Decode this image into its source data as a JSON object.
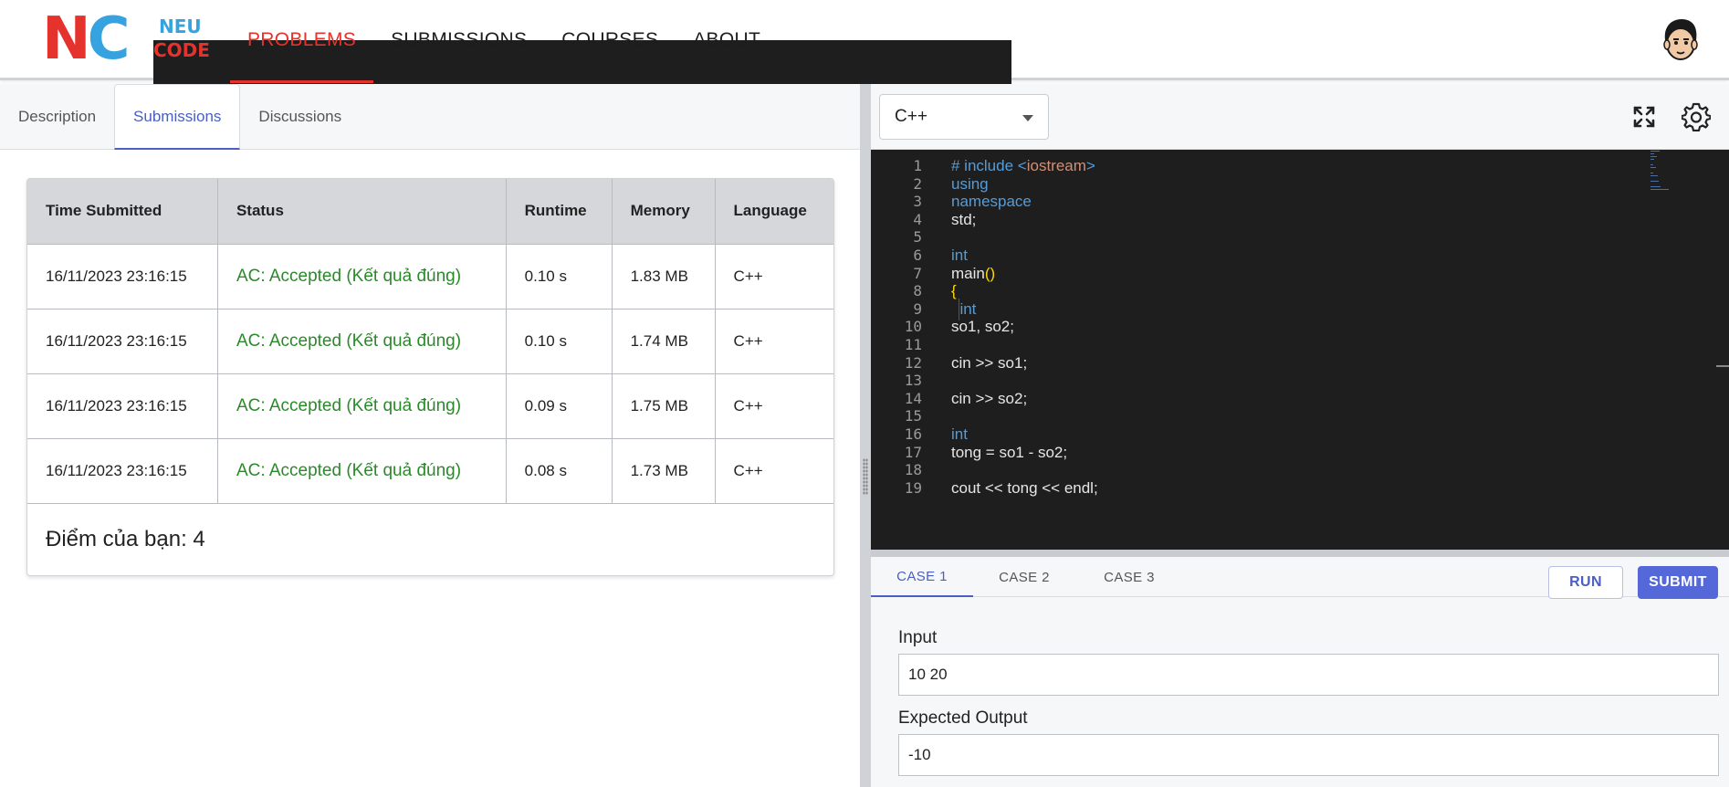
{
  "logo": {
    "big": "NC",
    "line1": "NEU",
    "line2": "CODE"
  },
  "nav": [
    {
      "label": "PROBLEMS",
      "active": true
    },
    {
      "label": "SUBMISSIONS",
      "active": false
    },
    {
      "label": "COURSES",
      "active": false
    },
    {
      "label": "ABOUT",
      "active": false
    }
  ],
  "left_tabs": [
    {
      "label": "Description",
      "active": false
    },
    {
      "label": "Submissions",
      "active": true
    },
    {
      "label": "Discussions",
      "active": false
    }
  ],
  "submissions": {
    "headers": [
      "Time Submitted",
      "Status",
      "Runtime",
      "Memory",
      "Language"
    ],
    "rows": [
      {
        "time": "16/11/2023 23:16:15",
        "status": "AC: Accepted (Kết quả đúng)",
        "runtime": "0.10 s",
        "memory": "1.83 MB",
        "language": "C++"
      },
      {
        "time": "16/11/2023 23:16:15",
        "status": "AC: Accepted (Kết quả đúng)",
        "runtime": "0.10 s",
        "memory": "1.74 MB",
        "language": "C++"
      },
      {
        "time": "16/11/2023 23:16:15",
        "status": "AC: Accepted (Kết quả đúng)",
        "runtime": "0.09 s",
        "memory": "1.75 MB",
        "language": "C++"
      },
      {
        "time": "16/11/2023 23:16:15",
        "status": "AC: Accepted (Kết quả đúng)",
        "runtime": "0.08 s",
        "memory": "1.73 MB",
        "language": "C++"
      }
    ],
    "score_text": "Điểm của bạn: 4"
  },
  "editor": {
    "language": "C++",
    "lines": [
      {
        "n": "1",
        "tokens": [
          [
            "kw",
            "# include "
          ],
          [
            "kw",
            "<"
          ],
          [
            "str",
            "iostream"
          ],
          [
            "kw",
            ">"
          ]
        ]
      },
      {
        "n": "2",
        "tokens": [
          [
            "kw",
            "using"
          ]
        ]
      },
      {
        "n": "3",
        "tokens": [
          [
            "kw",
            "namespace"
          ]
        ]
      },
      {
        "n": "4",
        "tokens": [
          [
            "",
            "std;"
          ]
        ]
      },
      {
        "n": "5",
        "tokens": []
      },
      {
        "n": "6",
        "tokens": [
          [
            "kw",
            "int"
          ]
        ]
      },
      {
        "n": "7",
        "tokens": [
          [
            "",
            "main"
          ],
          [
            "br",
            "()"
          ]
        ]
      },
      {
        "n": "8",
        "tokens": [
          [
            "br",
            "{"
          ]
        ]
      },
      {
        "n": "9",
        "tokens": [
          [
            "kw",
            "  int"
          ]
        ],
        "guide": true
      },
      {
        "n": "10",
        "tokens": [
          [
            "",
            "so1, so2;"
          ]
        ]
      },
      {
        "n": "11",
        "tokens": []
      },
      {
        "n": "12",
        "tokens": [
          [
            "",
            "cin >> so1;"
          ]
        ]
      },
      {
        "n": "13",
        "tokens": []
      },
      {
        "n": "14",
        "tokens": [
          [
            "",
            "cin >> so2;"
          ]
        ]
      },
      {
        "n": "15",
        "tokens": []
      },
      {
        "n": "16",
        "tokens": [
          [
            "kw",
            "int"
          ]
        ]
      },
      {
        "n": "17",
        "tokens": [
          [
            "",
            "tong = so1 - so2;"
          ]
        ]
      },
      {
        "n": "18",
        "tokens": []
      },
      {
        "n": "19",
        "tokens": [
          [
            "",
            "cout << tong << endl;"
          ]
        ]
      }
    ]
  },
  "cases": {
    "tabs": [
      {
        "label": "CASE 1",
        "active": true
      },
      {
        "label": "CASE 2",
        "active": false
      },
      {
        "label": "CASE 3",
        "active": false
      }
    ],
    "run_label": "RUN",
    "submit_label": "SUBMIT",
    "input_label": "Input",
    "input_value": "10 20",
    "output_label": "Expected Output",
    "output_value": "-10"
  },
  "colors": {
    "accent_red": "#e5322d",
    "accent_blue": "#4a5fc1",
    "success": "#2a8a2a",
    "editor_bg": "#1e1e1e"
  },
  "icons": {
    "fullscreen": "fullscreen-icon",
    "settings": "gear-icon",
    "dropdown": "chevron-down-icon"
  }
}
